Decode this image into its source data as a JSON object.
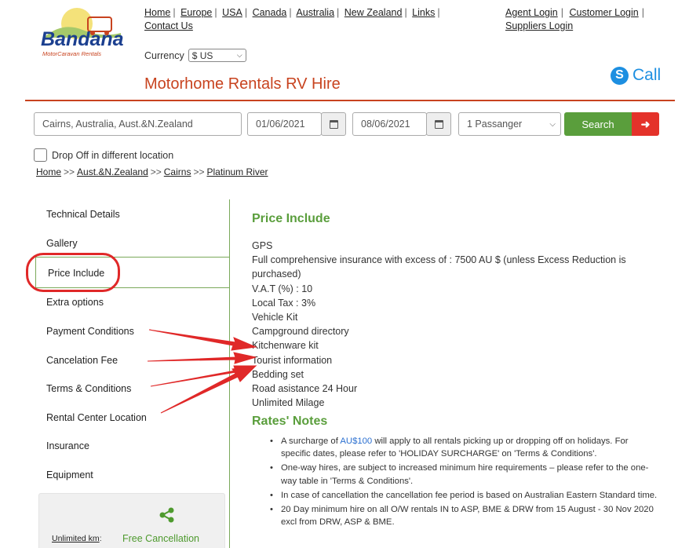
{
  "header": {
    "logo_text": "Bandana",
    "logo_sub": "MotorCaravan Rentals",
    "nav": [
      "Home",
      "Europe",
      "USA",
      "Canada",
      "Australia",
      "New Zealand",
      "Links",
      "Contact Us"
    ],
    "agent_login": "Agent Login",
    "customer_login": "Customer Login",
    "suppliers_login": "Suppliers Login",
    "currency_label": "Currency",
    "currency_value": "$ US",
    "site_title": "Motorhome Rentals RV Hire",
    "call_label": "Call"
  },
  "search": {
    "location": "Cairns, Australia, Aust.&N.Zealand",
    "pickup_date": "01/06/2021",
    "dropoff_date": "08/06/2021",
    "passengers": "1 Passanger",
    "search_label": "Search",
    "dropoff_label": "Drop Off in different location"
  },
  "breadcrumb": [
    "Home",
    "Aust.&N.Zealand",
    "Cairns",
    "Platinum River"
  ],
  "breadcrumb_sep": ">>",
  "sidebar": {
    "items": [
      "Technical Details",
      "Gallery",
      "Price Include",
      "Extra options",
      "Payment Conditions",
      "Cancelation Fee",
      "Terms & Conditions",
      "Rental Center Location",
      "Insurance",
      "Equipment"
    ],
    "active_index": 2,
    "unlimited_km": "Unlimited km",
    "free_cancellation": "Free Cancellation"
  },
  "price_include": {
    "title": "Price Include",
    "lines": [
      "GPS",
      "Full comprehensive insurance with excess of : 7500 AU $ (unless Excess Reduction is purchased)",
      "V.A.T (%) : 10",
      "Local Tax : 3%",
      "Vehicle Kit",
      "Campground directory",
      "Kitchenware kit",
      "Tourist information",
      "Bedding set",
      "Road asistance 24 Hour",
      "Unlimited Milage"
    ]
  },
  "rates_notes": {
    "title": "Rates' Notes",
    "note1_pre": "A surcharge of ",
    "note1_amount": "AU$100",
    "note1_post": " will apply to all rentals picking up or dropping off on holidays. For specific dates, please refer to 'HOLIDAY SURCHARGE' on 'Terms & Conditions'.",
    "note2": "One-way hires, are subject to increased minimum hire requirements – please refer to the one-way table in 'Terms & Conditions'.",
    "note3": "In case of cancellation the cancellation fee period is based on Australian Eastern Standard time.",
    "note4": "20 Day minimum hire on all O/W rentals IN to ASP, BME & DRW from 15 August - 30 Nov 2020 excl from DRW, ASP & BME."
  },
  "colors": {
    "brand_red": "#c8431f",
    "accent_green": "#5a9e3c",
    "search_arrow_red": "#e4322a",
    "skype_blue": "#1d8fe1",
    "annotation_red": "#e02828"
  }
}
